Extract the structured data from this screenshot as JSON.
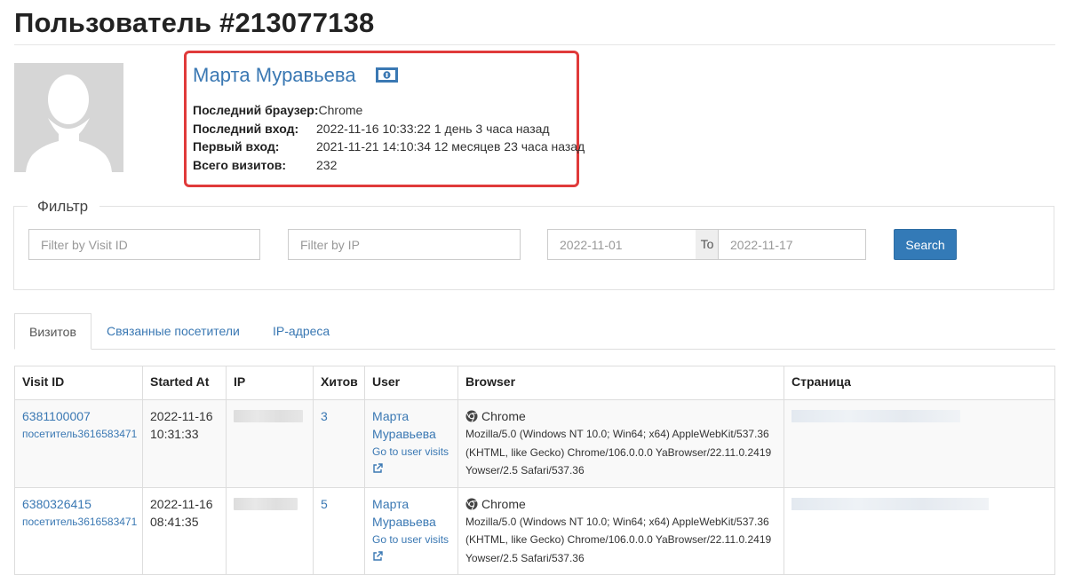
{
  "page": {
    "title": "Пользователь #213077138"
  },
  "user": {
    "name": "Марта Муравьева",
    "fields": [
      {
        "label": "Последний браузер:",
        "value": "Chrome"
      },
      {
        "label": "Последний вход:",
        "value": "2022-11-16 10:33:22 1 день 3 часа назад"
      },
      {
        "label": "Первый вход:",
        "value": "2021-11-21 14:10:34 12 месяцев 23 часа назад"
      },
      {
        "label": "Всего визитов:",
        "value": "232"
      }
    ]
  },
  "filter": {
    "legend": "Фильтр",
    "visit_id_placeholder": "Filter by Visit ID",
    "ip_placeholder": "Filter by IP",
    "date_from": "2022-11-01",
    "to_label": "To",
    "date_to": "2022-11-17",
    "search_label": "Search"
  },
  "tabs": [
    {
      "label": "Визитов",
      "active": true
    },
    {
      "label": "Связанные посетители",
      "active": false
    },
    {
      "label": "IP-адреса",
      "active": false
    }
  ],
  "table": {
    "headers": [
      "Visit ID",
      "Started At",
      "IP",
      "Хитов",
      "User",
      "Browser",
      "Страница"
    ],
    "rows": [
      {
        "visit_id": "6381100007",
        "visitor": "посетитель3616583471",
        "date": "2022-11-16",
        "time": "10:31:33",
        "hits": "3",
        "user_first": "Марта",
        "user_last": "Муравьева",
        "user_link": "Go to user visits",
        "browser": "Chrome",
        "ua": "Mozilla/5.0 (Windows NT 10.0; Win64; x64) AppleWebKit/537.36 (KHTML, like Gecko) Chrome/106.0.0.0 YaBrowser/22.11.0.2419 Yowser/2.5 Safari/537.36"
      },
      {
        "visit_id": "6380326415",
        "visitor": "посетитель3616583471",
        "date": "2022-11-16",
        "time": "08:41:35",
        "hits": "5",
        "user_first": "Марта",
        "user_last": "Муравьева",
        "user_link": "Go to user visits",
        "browser": "Chrome",
        "ua": "Mozilla/5.0 (Windows NT 10.0; Win64; x64) AppleWebKit/537.36 (KHTML, like Gecko) Chrome/106.0.0.0 YaBrowser/22.11.0.2419 Yowser/2.5 Safari/537.36"
      }
    ]
  },
  "colors": {
    "link": "#3a78b3",
    "highlight_border": "#e03a3a",
    "primary_button": "#337ab7"
  },
  "icons": [
    "avatar-placeholder-icon",
    "money-icon",
    "chrome-icon",
    "external-link-icon"
  ]
}
